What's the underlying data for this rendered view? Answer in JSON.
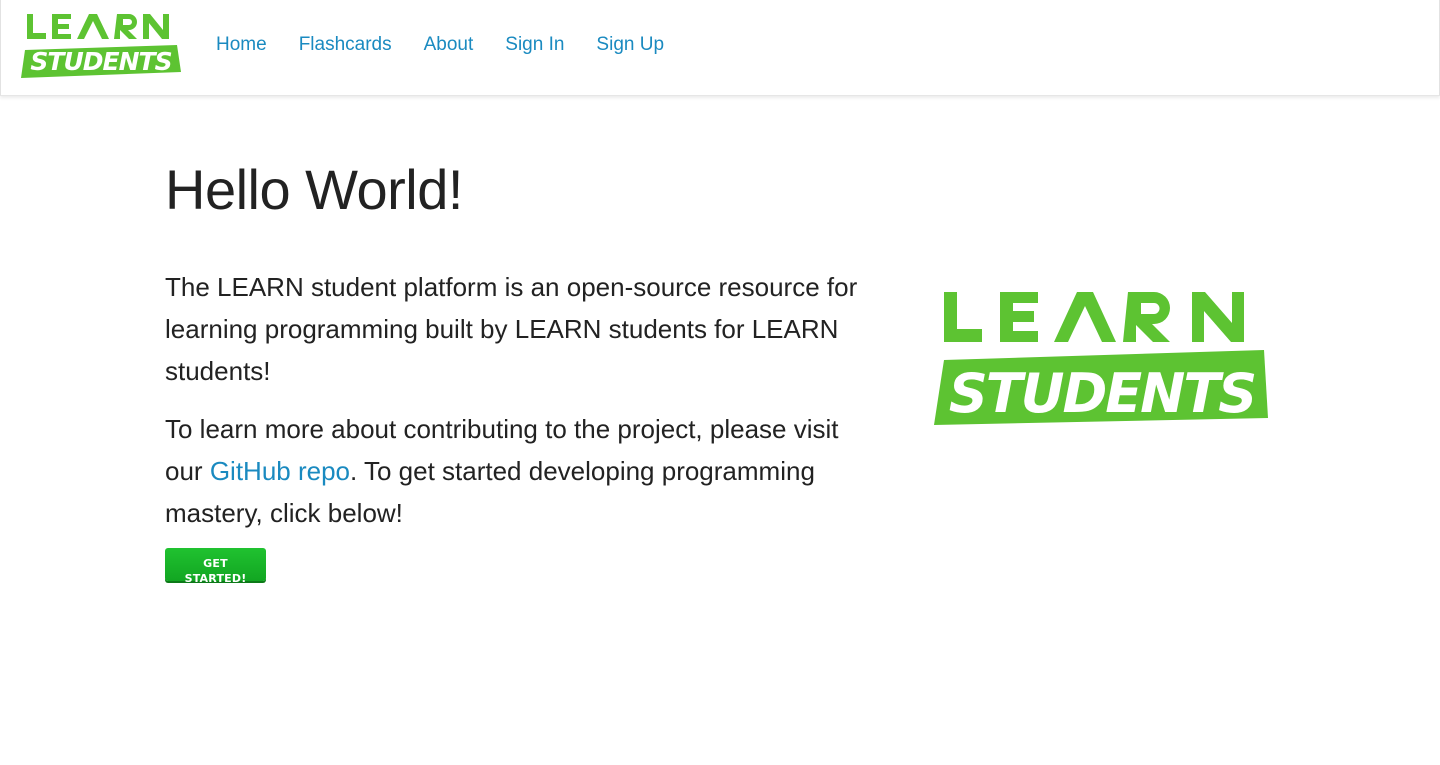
{
  "brand": {
    "logo_top": "LEARN",
    "logo_bottom": "STUDENTS",
    "green": "#5dc332"
  },
  "nav": {
    "links": [
      "Home",
      "Flashcards",
      "About",
      "Sign In",
      "Sign Up"
    ],
    "link_color": "#1a8ac0"
  },
  "main": {
    "title": "Hello World!",
    "para1": "The LEARN student platform is an open-source resource for learning programming built by LEARN students for LEARN students!",
    "para2_before": "To learn more about contributing to the project, please visit our ",
    "para2_link": "GitHub repo",
    "para2_after": ". To get started developing programming mastery, click below!",
    "cta_label": "GET STARTED!"
  },
  "hero_logo": {
    "top": "LEARN",
    "bottom": "STUDENTS"
  }
}
